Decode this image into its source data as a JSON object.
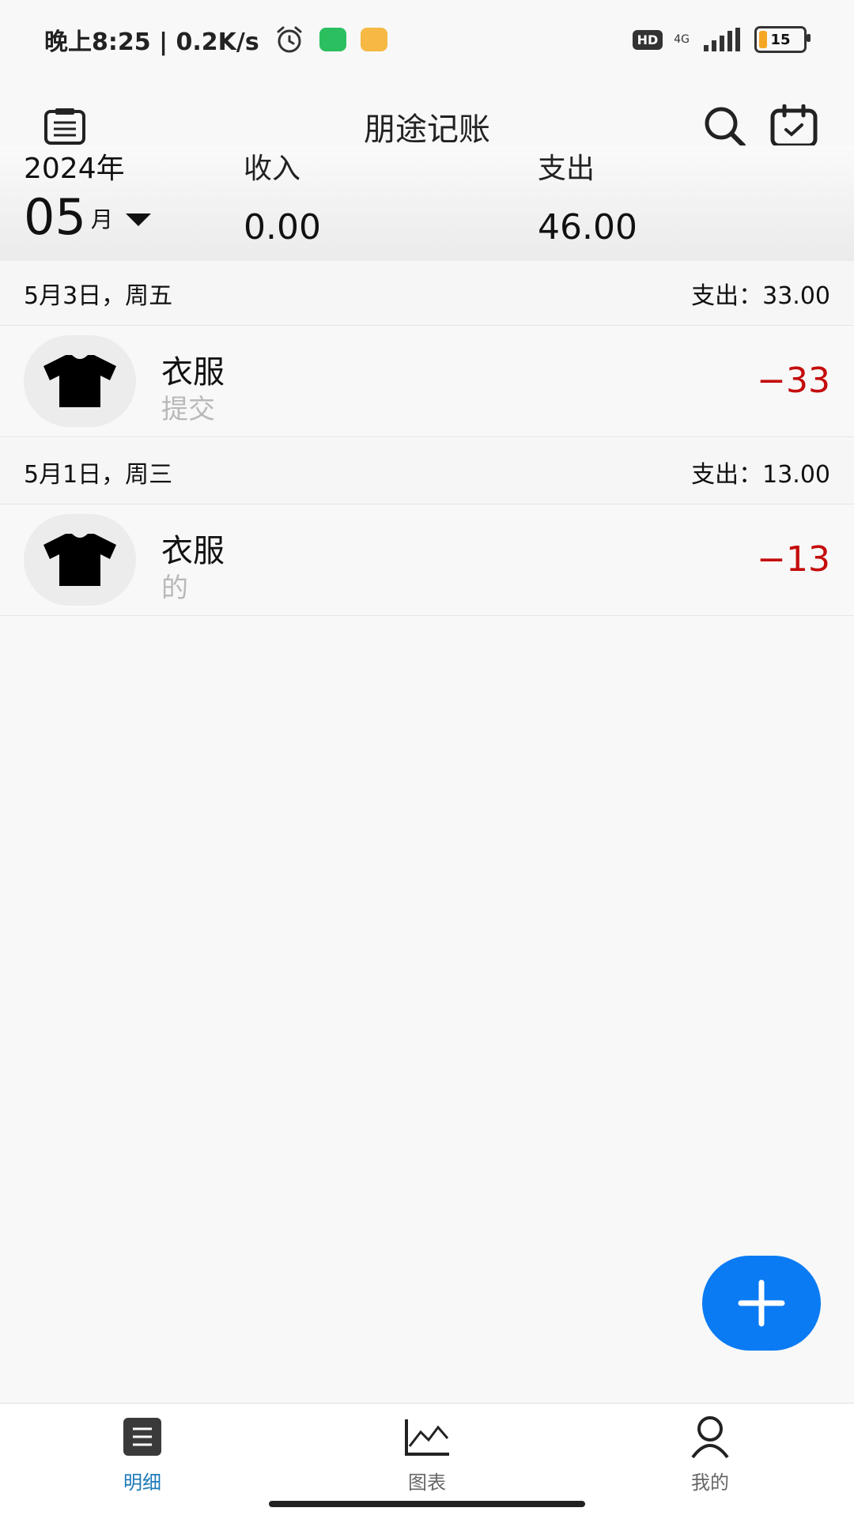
{
  "status": {
    "time_net": "晚上8:25 | 0.2K/s",
    "hd": "HD",
    "net": "4G",
    "battery": "15"
  },
  "app": {
    "title": "朋途记账"
  },
  "summary": {
    "year": "2024年",
    "month_num": "05",
    "month_unit": "月",
    "income_label": "收入",
    "income_value": "0.00",
    "expense_label": "支出",
    "expense_value": "46.00"
  },
  "days": [
    {
      "title": "5月3日，周五",
      "total": "支出：33.00",
      "entries": [
        {
          "category": "衣服",
          "note": "提交",
          "amount": "−33"
        }
      ]
    },
    {
      "title": "5月1日，周三",
      "total": "支出：13.00",
      "entries": [
        {
          "category": "衣服",
          "note": "的",
          "amount": "−13"
        }
      ]
    }
  ],
  "nav": {
    "detail": "明细",
    "chart": "图表",
    "me": "我的"
  },
  "colors": {
    "accent": "#0a7bf3",
    "expense": "#c40c0c",
    "nav_active": "#1b79b8"
  }
}
